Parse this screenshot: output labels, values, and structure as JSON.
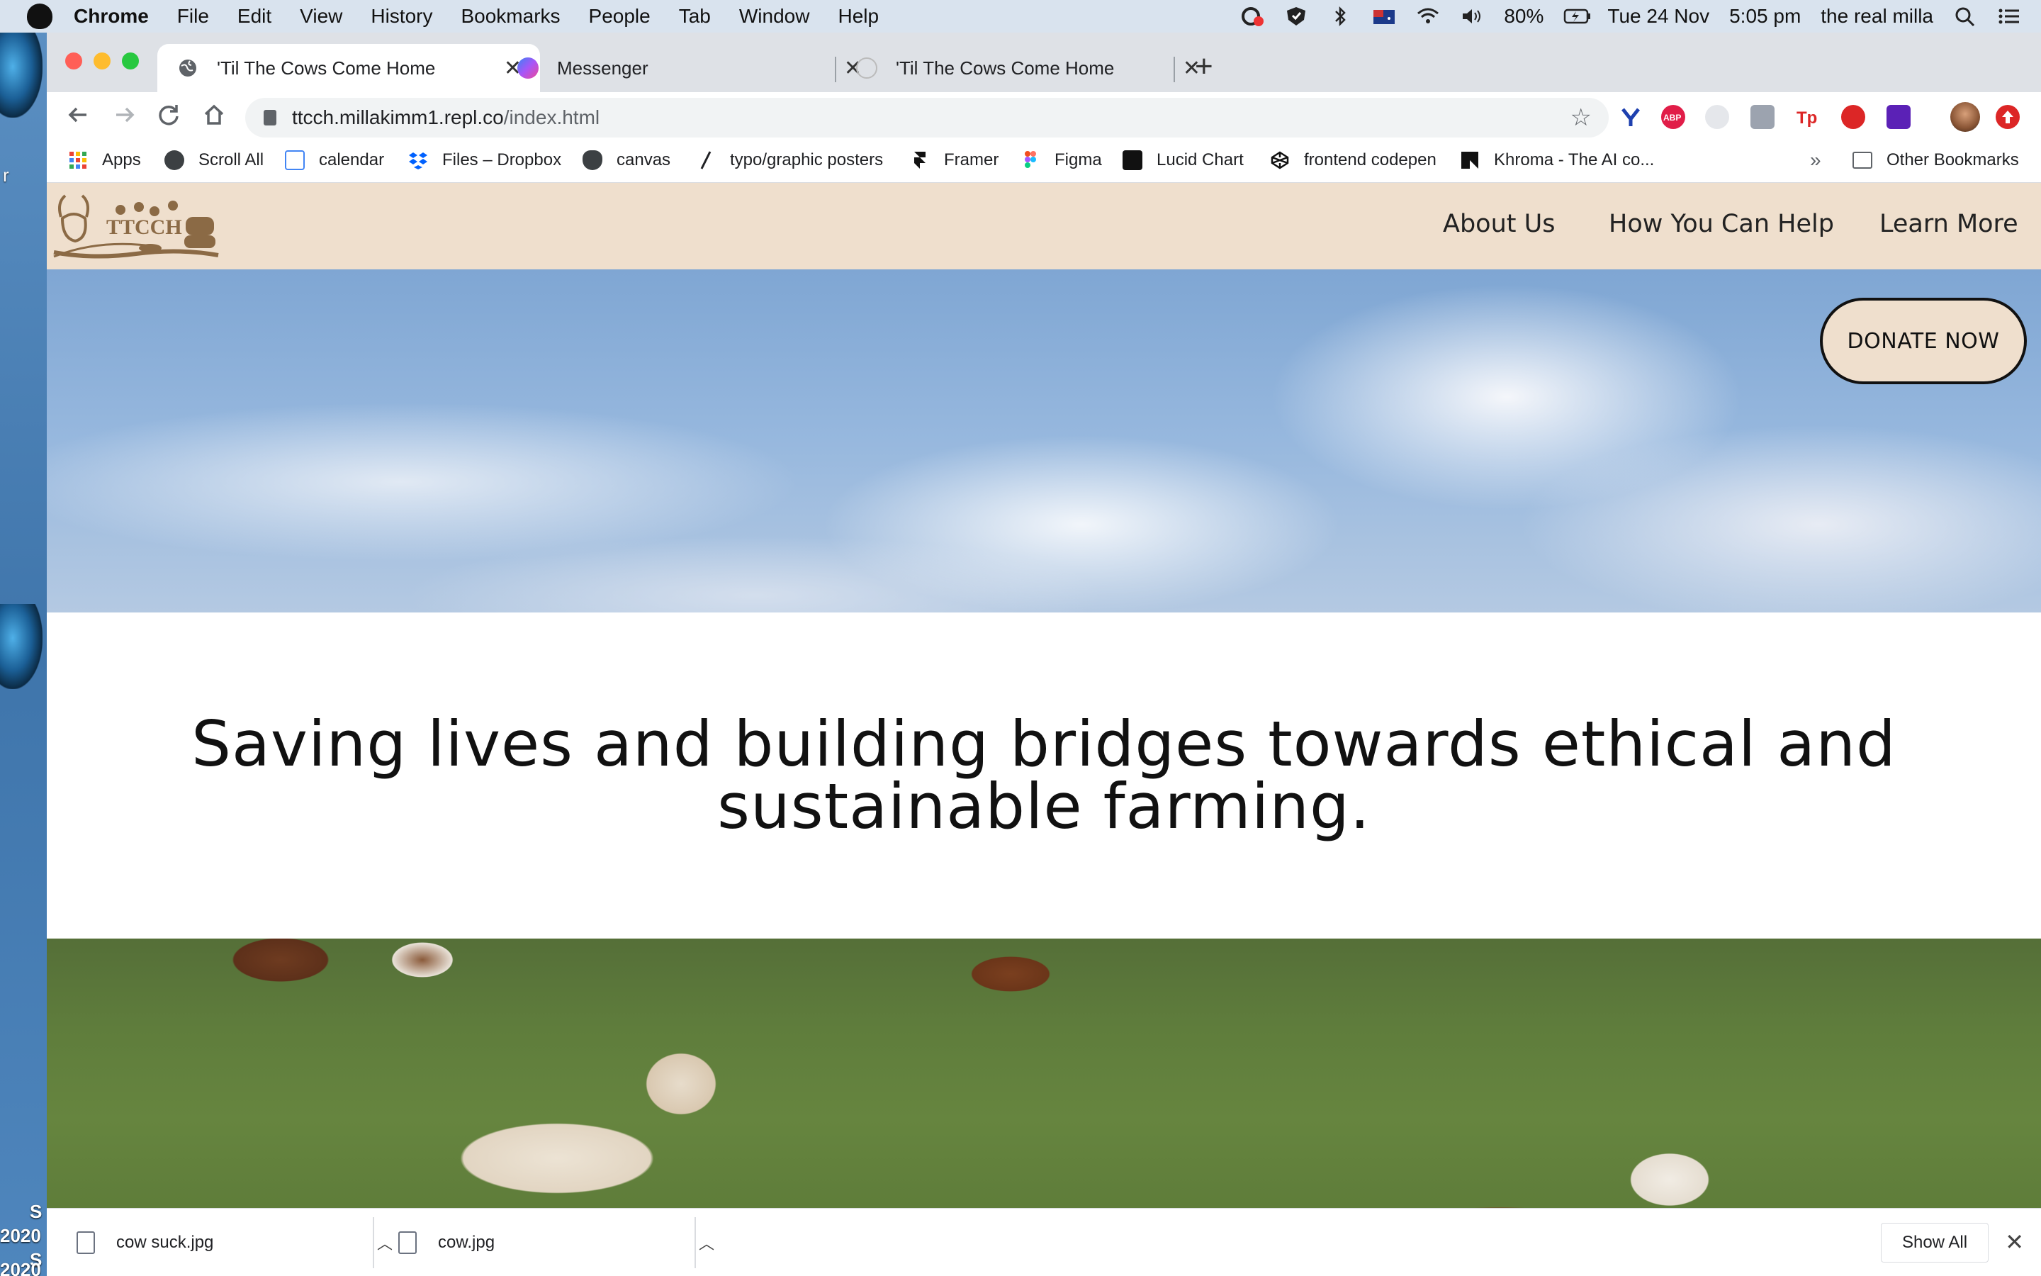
{
  "menubar": {
    "app": "Chrome",
    "items": [
      "File",
      "Edit",
      "View",
      "History",
      "Bookmarks",
      "People",
      "Tab",
      "Window",
      "Help"
    ],
    "battery": "80%",
    "date": "Tue 24 Nov",
    "time": "5:05 pm",
    "user": "the real milla"
  },
  "desktop": {
    "fragment_1": "r",
    "fragment_2": "S",
    "fragment_3": "2020",
    "fragment_4": "S",
    "fragment_5": "2020"
  },
  "tabs": [
    {
      "title": "'Til The Cows Come Home",
      "active": true,
      "icon": "globe-icon"
    },
    {
      "title": "Messenger",
      "active": false,
      "icon": "messenger-icon"
    },
    {
      "title": "'Til The Cows Come Home",
      "active": false,
      "icon": "loading-icon"
    }
  ],
  "omnibox": {
    "host": "ttcch.millakimm1.repl.co",
    "path": "/index.html"
  },
  "bookmarks": [
    {
      "label": "Apps",
      "icon": "apps-grid-icon"
    },
    {
      "label": "Scroll All",
      "icon": "globe-icon"
    },
    {
      "label": "calendar",
      "icon": "calendar-icon"
    },
    {
      "label": "Files – Dropbox",
      "icon": "dropbox-icon"
    },
    {
      "label": "canvas",
      "icon": "canvas-icon"
    },
    {
      "label": "typo/graphic posters",
      "icon": "slash-icon"
    },
    {
      "label": "Framer",
      "icon": "framer-icon"
    },
    {
      "label": "Figma",
      "icon": "figma-icon"
    },
    {
      "label": "Lucid Chart",
      "icon": "lucid-icon"
    },
    {
      "label": "frontend codepen",
      "icon": "codepen-icon"
    },
    {
      "label": "Khroma - The AI co...",
      "icon": "khroma-icon"
    }
  ],
  "bookmarks_more": "»",
  "other_bookmarks": "Other Bookmarks",
  "site": {
    "logo_text": "TTCCH",
    "nav": [
      "About Us",
      "How You Can Help",
      "Learn More"
    ],
    "donate": "DONATE NOW",
    "tagline": "Saving lives and building bridges towards ethical and sustainable farming."
  },
  "downloads": [
    {
      "name": "cow suck.jpg"
    },
    {
      "name": "cow.jpg"
    }
  ],
  "show_all": "Show All",
  "colors": {
    "header_bg": "#efdfcd",
    "logo_brown": "#8b6a45",
    "tab_strip": "#dee1e6",
    "close_red": "#ff5f57",
    "min_yellow": "#febc2e",
    "max_green": "#28c840"
  }
}
